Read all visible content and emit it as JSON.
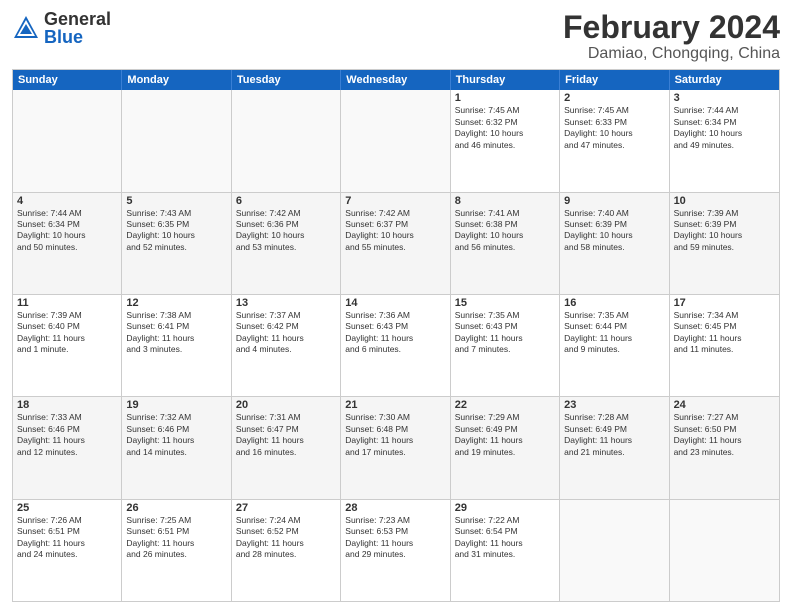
{
  "header": {
    "logo": {
      "general": "General",
      "blue": "Blue"
    },
    "title": "February 2024",
    "subtitle": "Damiao, Chongqing, China"
  },
  "calendar": {
    "days": [
      "Sunday",
      "Monday",
      "Tuesday",
      "Wednesday",
      "Thursday",
      "Friday",
      "Saturday"
    ],
    "rows": [
      [
        {
          "day": "",
          "empty": true
        },
        {
          "day": "",
          "empty": true
        },
        {
          "day": "",
          "empty": true
        },
        {
          "day": "",
          "empty": true
        },
        {
          "day": "1",
          "lines": [
            "Sunrise: 7:45 AM",
            "Sunset: 6:32 PM",
            "Daylight: 10 hours",
            "and 46 minutes."
          ]
        },
        {
          "day": "2",
          "lines": [
            "Sunrise: 7:45 AM",
            "Sunset: 6:33 PM",
            "Daylight: 10 hours",
            "and 47 minutes."
          ]
        },
        {
          "day": "3",
          "lines": [
            "Sunrise: 7:44 AM",
            "Sunset: 6:34 PM",
            "Daylight: 10 hours",
            "and 49 minutes."
          ]
        }
      ],
      [
        {
          "day": "4",
          "lines": [
            "Sunrise: 7:44 AM",
            "Sunset: 6:34 PM",
            "Daylight: 10 hours",
            "and 50 minutes."
          ],
          "shaded": true
        },
        {
          "day": "5",
          "lines": [
            "Sunrise: 7:43 AM",
            "Sunset: 6:35 PM",
            "Daylight: 10 hours",
            "and 52 minutes."
          ],
          "shaded": true
        },
        {
          "day": "6",
          "lines": [
            "Sunrise: 7:42 AM",
            "Sunset: 6:36 PM",
            "Daylight: 10 hours",
            "and 53 minutes."
          ],
          "shaded": true
        },
        {
          "day": "7",
          "lines": [
            "Sunrise: 7:42 AM",
            "Sunset: 6:37 PM",
            "Daylight: 10 hours",
            "and 55 minutes."
          ],
          "shaded": true
        },
        {
          "day": "8",
          "lines": [
            "Sunrise: 7:41 AM",
            "Sunset: 6:38 PM",
            "Daylight: 10 hours",
            "and 56 minutes."
          ],
          "shaded": true
        },
        {
          "day": "9",
          "lines": [
            "Sunrise: 7:40 AM",
            "Sunset: 6:39 PM",
            "Daylight: 10 hours",
            "and 58 minutes."
          ],
          "shaded": true
        },
        {
          "day": "10",
          "lines": [
            "Sunrise: 7:39 AM",
            "Sunset: 6:39 PM",
            "Daylight: 10 hours",
            "and 59 minutes."
          ],
          "shaded": true
        }
      ],
      [
        {
          "day": "11",
          "lines": [
            "Sunrise: 7:39 AM",
            "Sunset: 6:40 PM",
            "Daylight: 11 hours",
            "and 1 minute."
          ]
        },
        {
          "day": "12",
          "lines": [
            "Sunrise: 7:38 AM",
            "Sunset: 6:41 PM",
            "Daylight: 11 hours",
            "and 3 minutes."
          ]
        },
        {
          "day": "13",
          "lines": [
            "Sunrise: 7:37 AM",
            "Sunset: 6:42 PM",
            "Daylight: 11 hours",
            "and 4 minutes."
          ]
        },
        {
          "day": "14",
          "lines": [
            "Sunrise: 7:36 AM",
            "Sunset: 6:43 PM",
            "Daylight: 11 hours",
            "and 6 minutes."
          ]
        },
        {
          "day": "15",
          "lines": [
            "Sunrise: 7:35 AM",
            "Sunset: 6:43 PM",
            "Daylight: 11 hours",
            "and 7 minutes."
          ]
        },
        {
          "day": "16",
          "lines": [
            "Sunrise: 7:35 AM",
            "Sunset: 6:44 PM",
            "Daylight: 11 hours",
            "and 9 minutes."
          ]
        },
        {
          "day": "17",
          "lines": [
            "Sunrise: 7:34 AM",
            "Sunset: 6:45 PM",
            "Daylight: 11 hours",
            "and 11 minutes."
          ]
        }
      ],
      [
        {
          "day": "18",
          "lines": [
            "Sunrise: 7:33 AM",
            "Sunset: 6:46 PM",
            "Daylight: 11 hours",
            "and 12 minutes."
          ],
          "shaded": true
        },
        {
          "day": "19",
          "lines": [
            "Sunrise: 7:32 AM",
            "Sunset: 6:46 PM",
            "Daylight: 11 hours",
            "and 14 minutes."
          ],
          "shaded": true
        },
        {
          "day": "20",
          "lines": [
            "Sunrise: 7:31 AM",
            "Sunset: 6:47 PM",
            "Daylight: 11 hours",
            "and 16 minutes."
          ],
          "shaded": true
        },
        {
          "day": "21",
          "lines": [
            "Sunrise: 7:30 AM",
            "Sunset: 6:48 PM",
            "Daylight: 11 hours",
            "and 17 minutes."
          ],
          "shaded": true
        },
        {
          "day": "22",
          "lines": [
            "Sunrise: 7:29 AM",
            "Sunset: 6:49 PM",
            "Daylight: 11 hours",
            "and 19 minutes."
          ],
          "shaded": true
        },
        {
          "day": "23",
          "lines": [
            "Sunrise: 7:28 AM",
            "Sunset: 6:49 PM",
            "Daylight: 11 hours",
            "and 21 minutes."
          ],
          "shaded": true
        },
        {
          "day": "24",
          "lines": [
            "Sunrise: 7:27 AM",
            "Sunset: 6:50 PM",
            "Daylight: 11 hours",
            "and 23 minutes."
          ],
          "shaded": true
        }
      ],
      [
        {
          "day": "25",
          "lines": [
            "Sunrise: 7:26 AM",
            "Sunset: 6:51 PM",
            "Daylight: 11 hours",
            "and 24 minutes."
          ]
        },
        {
          "day": "26",
          "lines": [
            "Sunrise: 7:25 AM",
            "Sunset: 6:51 PM",
            "Daylight: 11 hours",
            "and 26 minutes."
          ]
        },
        {
          "day": "27",
          "lines": [
            "Sunrise: 7:24 AM",
            "Sunset: 6:52 PM",
            "Daylight: 11 hours",
            "and 28 minutes."
          ]
        },
        {
          "day": "28",
          "lines": [
            "Sunrise: 7:23 AM",
            "Sunset: 6:53 PM",
            "Daylight: 11 hours",
            "and 29 minutes."
          ]
        },
        {
          "day": "29",
          "lines": [
            "Sunrise: 7:22 AM",
            "Sunset: 6:54 PM",
            "Daylight: 11 hours",
            "and 31 minutes."
          ]
        },
        {
          "day": "",
          "empty": true
        },
        {
          "day": "",
          "empty": true
        }
      ]
    ]
  }
}
